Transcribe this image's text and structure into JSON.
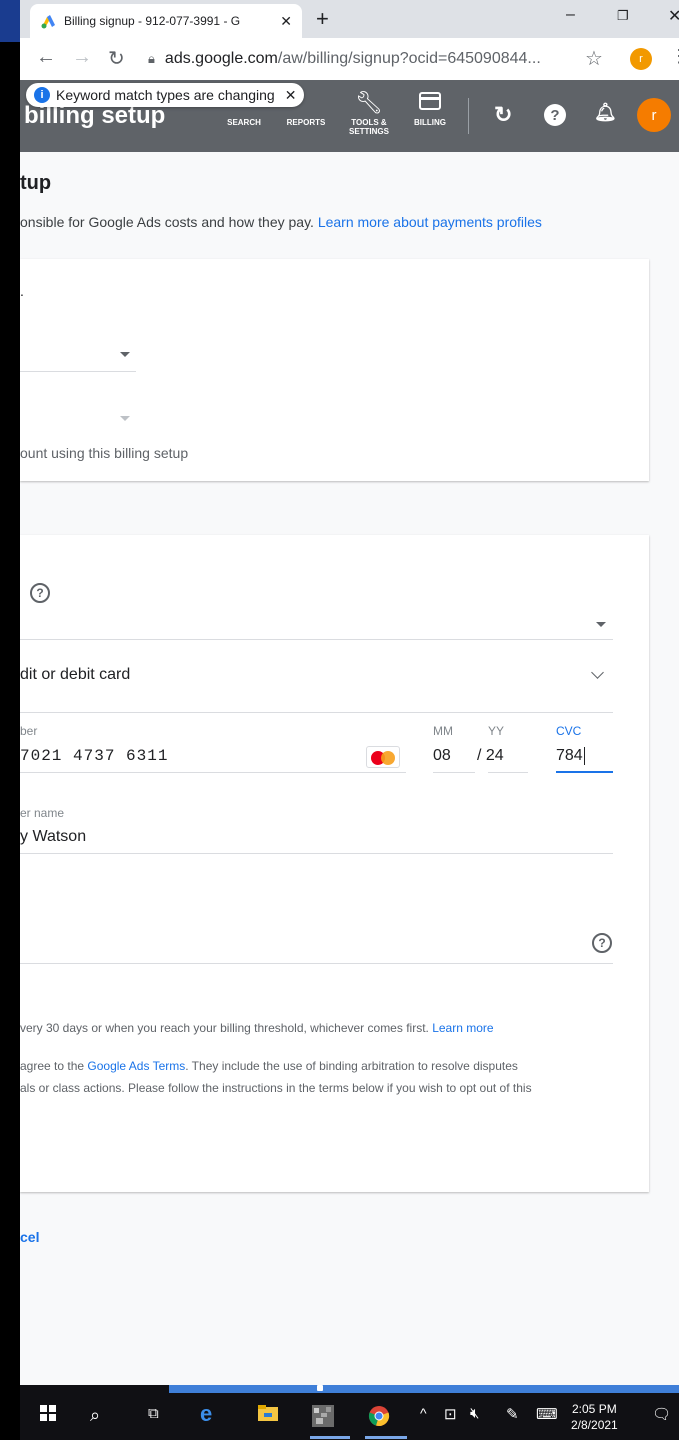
{
  "browser": {
    "tab_title": "Billing signup - 912-077-3991 - G",
    "new_tab": "+",
    "url_host": "ads.google.com",
    "url_path": "/aw/billing/signup?ocid=645090844...",
    "profile_initial": "r"
  },
  "ads_header": {
    "notice": "Keyword match types are changing",
    "page_heading": "billing setup",
    "nav": [
      {
        "label": "SEARCH"
      },
      {
        "label": "REPORTS"
      },
      {
        "label": "TOOLS &\nSETTINGS"
      },
      {
        "label": "BILLING"
      }
    ],
    "avatar_initial": "r"
  },
  "page": {
    "title": "tup",
    "subtitle": "onsible for Google Ads costs and how they pay.",
    "subtitle_link": "Learn more about payments profiles",
    "card1": {
      "letter": ".",
      "helper": "ount using this billing setup"
    },
    "card2": {
      "payment_method": "dit or debit card",
      "card_number_label": "ber",
      "card_number": "7021 4737 6311",
      "mm_label": "MM",
      "mm_value": "08",
      "yy_label": "YY",
      "yy_value": "/ 24",
      "cvc_label": "CVC",
      "cvc_value": "784",
      "holder_label": "er name",
      "holder_value": "y Watson",
      "billing_note": "very 30 days or when you reach your billing threshold, whichever comes first.",
      "billing_note_link": "Learn more",
      "terms_line1_pre": " agree to the",
      "terms_link": "Google Ads Terms",
      "terms_line1_post": ". They include the use of binding arbitration to resolve disputes",
      "terms_line2": "als or class actions. Please follow the instructions in the terms below if you wish to opt out of this"
    },
    "cancel": "cel"
  },
  "taskbar": {
    "time": "2:05 PM",
    "date": "2/8/2021"
  },
  "colors": {
    "accent": "#1a73e8",
    "header_bg": "#5f6368",
    "avatar": "#f57c00"
  }
}
